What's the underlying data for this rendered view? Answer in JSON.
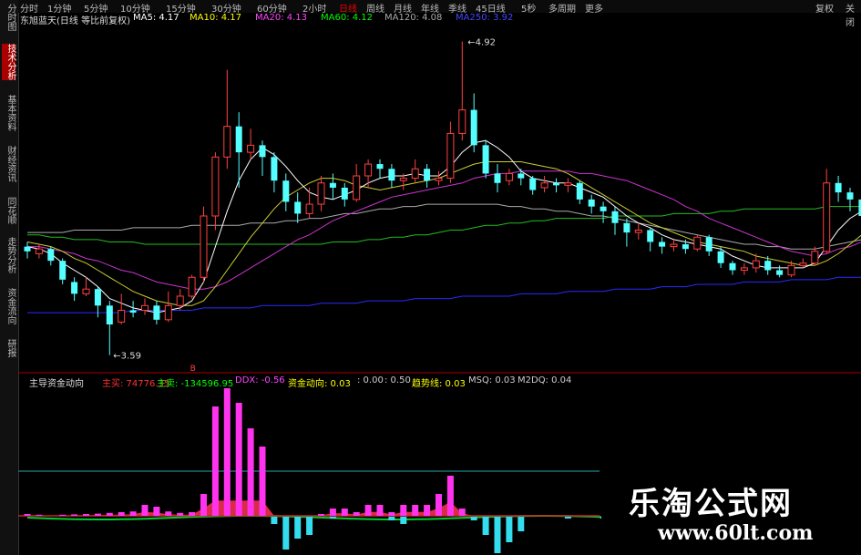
{
  "left_tabs": [
    {
      "label": "分时图",
      "active": false
    },
    {
      "label": "技术分析",
      "active": true
    },
    {
      "label": "基本资料",
      "active": false
    },
    {
      "label": "财经资讯",
      "active": false
    },
    {
      "label": "同花顺",
      "active": false
    },
    {
      "label": "走势分析",
      "active": false
    },
    {
      "label": "资金流向",
      "active": false
    },
    {
      "label": "研报",
      "active": false
    }
  ],
  "period_tabs": [
    "分时",
    "1分钟",
    "5分钟",
    "10分钟",
    "15分钟",
    "30分钟",
    "60分钟",
    "2小时",
    "日线",
    "周线",
    "月线",
    "年线",
    "季线",
    "45日线",
    "5秒",
    "多周期",
    "更多"
  ],
  "active_period": "日线",
  "right_menu": {
    "restore": "复权",
    "close": "关闭"
  },
  "main_legend": {
    "title": "东旭蓝天(日线 等比前复权)",
    "ma5": "MA5: 4.17",
    "ma10": "MA10: 4.17",
    "ma20": "MA20: 4.13",
    "ma60": "MA60: 4.12",
    "ma120": "MA120: 4.08",
    "ma250": "MA250: 3.92",
    "colors": {
      "ma5": "#ffffff",
      "ma10": "#ffff00",
      "ma20": "#ff44ff",
      "ma60": "#00ff00",
      "ma120": "#aaaaaa",
      "ma250": "#3333ff"
    }
  },
  "annotations": {
    "high": "4.92",
    "low": "3.59",
    "signal": "B"
  },
  "sub_legend": {
    "title": "主导资金动向",
    "main_buy": "主买: 74776.35",
    "main_sell": "主卖: -134596.95",
    "ddx": "DDX: -0.56",
    "fund_move": "资金动向: 0.03",
    "v1": ": 0.00",
    "v2": ": 0.50",
    "trend": "趋势线: 0.03",
    "msq": "MSQ: 0.03",
    "m2dq": "M2DQ: 0.04"
  },
  "watermark": {
    "name": "乐淘公式网",
    "url": "www.60lt.com"
  },
  "chart_data": {
    "type": "candlestick",
    "price_range": [
      3.59,
      4.92
    ],
    "candles": [
      {
        "o": 4.05,
        "c": 4.03,
        "h": 4.07,
        "l": 4.0
      },
      {
        "o": 4.02,
        "c": 4.04,
        "h": 4.06,
        "l": 4.0
      },
      {
        "o": 4.04,
        "c": 3.99,
        "h": 4.05,
        "l": 3.97
      },
      {
        "o": 3.99,
        "c": 3.91,
        "h": 4.0,
        "l": 3.89
      },
      {
        "o": 3.9,
        "c": 3.85,
        "h": 3.92,
        "l": 3.82
      },
      {
        "o": 3.85,
        "c": 3.87,
        "h": 3.92,
        "l": 3.84
      },
      {
        "o": 3.87,
        "c": 3.8,
        "h": 3.88,
        "l": 3.75
      },
      {
        "o": 3.8,
        "c": 3.72,
        "h": 3.82,
        "l": 3.59
      },
      {
        "o": 3.73,
        "c": 3.78,
        "h": 3.85,
        "l": 3.72
      },
      {
        "o": 3.78,
        "c": 3.77,
        "h": 3.82,
        "l": 3.75
      },
      {
        "o": 3.78,
        "c": 3.8,
        "h": 3.83,
        "l": 3.76
      },
      {
        "o": 3.8,
        "c": 3.74,
        "h": 3.82,
        "l": 3.72
      },
      {
        "o": 3.74,
        "c": 3.8,
        "h": 3.86,
        "l": 3.73
      },
      {
        "o": 3.8,
        "c": 3.84,
        "h": 3.87,
        "l": 3.78
      },
      {
        "o": 3.84,
        "c": 3.92,
        "h": 3.93,
        "l": 3.83
      },
      {
        "o": 3.92,
        "c": 4.18,
        "h": 4.22,
        "l": 3.9
      },
      {
        "o": 4.18,
        "c": 4.43,
        "h": 4.45,
        "l": 4.12
      },
      {
        "o": 4.43,
        "c": 4.56,
        "h": 4.8,
        "l": 4.38
      },
      {
        "o": 4.56,
        "c": 4.45,
        "h": 4.62,
        "l": 4.3
      },
      {
        "o": 4.45,
        "c": 4.48,
        "h": 4.55,
        "l": 4.42
      },
      {
        "o": 4.48,
        "c": 4.43,
        "h": 4.5,
        "l": 4.35
      },
      {
        "o": 4.43,
        "c": 4.33,
        "h": 4.45,
        "l": 4.28
      },
      {
        "o": 4.33,
        "c": 4.24,
        "h": 4.36,
        "l": 4.2
      },
      {
        "o": 4.24,
        "c": 4.19,
        "h": 4.28,
        "l": 4.15
      },
      {
        "o": 4.19,
        "c": 4.23,
        "h": 4.3,
        "l": 4.17
      },
      {
        "o": 4.23,
        "c": 4.32,
        "h": 4.35,
        "l": 4.2
      },
      {
        "o": 4.32,
        "c": 4.3,
        "h": 4.36,
        "l": 4.25
      },
      {
        "o": 4.3,
        "c": 4.25,
        "h": 4.32,
        "l": 4.22
      },
      {
        "o": 4.25,
        "c": 4.35,
        "h": 4.4,
        "l": 4.24
      },
      {
        "o": 4.35,
        "c": 4.4,
        "h": 4.42,
        "l": 4.3
      },
      {
        "o": 4.4,
        "c": 4.38,
        "h": 4.42,
        "l": 4.34
      },
      {
        "o": 4.38,
        "c": 4.33,
        "h": 4.4,
        "l": 4.3
      },
      {
        "o": 4.33,
        "c": 4.34,
        "h": 4.36,
        "l": 4.29
      },
      {
        "o": 4.34,
        "c": 4.38,
        "h": 4.42,
        "l": 4.32
      },
      {
        "o": 4.38,
        "c": 4.33,
        "h": 4.4,
        "l": 4.3
      },
      {
        "o": 4.33,
        "c": 4.34,
        "h": 4.37,
        "l": 4.31
      },
      {
        "o": 4.34,
        "c": 4.53,
        "h": 4.58,
        "l": 4.32
      },
      {
        "o": 4.53,
        "c": 4.63,
        "h": 4.92,
        "l": 4.5
      },
      {
        "o": 4.63,
        "c": 4.48,
        "h": 4.7,
        "l": 4.45
      },
      {
        "o": 4.48,
        "c": 4.36,
        "h": 4.5,
        "l": 4.34
      },
      {
        "o": 4.36,
        "c": 4.32,
        "h": 4.4,
        "l": 4.28
      },
      {
        "o": 4.33,
        "c": 4.36,
        "h": 4.38,
        "l": 4.31
      },
      {
        "o": 4.36,
        "c": 4.34,
        "h": 4.38,
        "l": 4.31
      },
      {
        "o": 4.34,
        "c": 4.29,
        "h": 4.35,
        "l": 4.27
      },
      {
        "o": 4.3,
        "c": 4.32,
        "h": 4.35,
        "l": 4.28
      },
      {
        "o": 4.32,
        "c": 4.31,
        "h": 4.34,
        "l": 4.28
      },
      {
        "o": 4.31,
        "c": 4.32,
        "h": 4.34,
        "l": 4.28
      },
      {
        "o": 4.32,
        "c": 4.25,
        "h": 4.33,
        "l": 4.23
      },
      {
        "o": 4.25,
        "c": 4.22,
        "h": 4.27,
        "l": 4.19
      },
      {
        "o": 4.22,
        "c": 4.2,
        "h": 4.24,
        "l": 4.15
      },
      {
        "o": 4.2,
        "c": 4.15,
        "h": 4.22,
        "l": 4.1
      },
      {
        "o": 4.15,
        "c": 4.11,
        "h": 4.17,
        "l": 4.05
      },
      {
        "o": 4.11,
        "c": 4.12,
        "h": 4.15,
        "l": 4.08
      },
      {
        "o": 4.12,
        "c": 4.07,
        "h": 4.13,
        "l": 4.03
      },
      {
        "o": 4.07,
        "c": 4.05,
        "h": 4.09,
        "l": 4.02
      },
      {
        "o": 4.05,
        "c": 4.06,
        "h": 4.08,
        "l": 4.03
      },
      {
        "o": 4.06,
        "c": 4.04,
        "h": 4.08,
        "l": 4.02
      },
      {
        "o": 4.04,
        "c": 4.09,
        "h": 4.1,
        "l": 4.03
      },
      {
        "o": 4.09,
        "c": 4.03,
        "h": 4.1,
        "l": 4.01
      },
      {
        "o": 4.03,
        "c": 3.98,
        "h": 4.05,
        "l": 3.96
      },
      {
        "o": 3.98,
        "c": 3.95,
        "h": 3.99,
        "l": 3.93
      },
      {
        "o": 3.95,
        "c": 3.96,
        "h": 3.98,
        "l": 3.93
      },
      {
        "o": 3.96,
        "c": 3.99,
        "h": 4.02,
        "l": 3.94
      },
      {
        "o": 3.99,
        "c": 3.95,
        "h": 4.01,
        "l": 3.93
      },
      {
        "o": 3.95,
        "c": 3.93,
        "h": 3.97,
        "l": 3.92
      },
      {
        "o": 3.93,
        "c": 3.97,
        "h": 3.99,
        "l": 3.92
      },
      {
        "o": 3.97,
        "c": 3.98,
        "h": 4.0,
        "l": 3.96
      },
      {
        "o": 3.98,
        "c": 4.03,
        "h": 4.05,
        "l": 3.97
      },
      {
        "o": 4.03,
        "c": 4.32,
        "h": 4.38,
        "l": 4.02
      },
      {
        "o": 4.32,
        "c": 4.28,
        "h": 4.35,
        "l": 4.24
      },
      {
        "o": 4.28,
        "c": 4.25,
        "h": 4.3,
        "l": 4.2
      },
      {
        "o": 4.25,
        "c": 4.18,
        "h": 4.27,
        "l": 4.14
      }
    ],
    "ma5": [
      4.05,
      4.04,
      4.02,
      3.98,
      3.95,
      3.92,
      3.88,
      3.83,
      3.81,
      3.79,
      3.78,
      3.77,
      3.78,
      3.79,
      3.82,
      3.9,
      4.05,
      4.2,
      4.33,
      4.42,
      4.47,
      4.44,
      4.39,
      4.33,
      4.28,
      4.26,
      4.25,
      4.27,
      4.29,
      4.32,
      4.34,
      4.35,
      4.35,
      4.36,
      4.35,
      4.35,
      4.39,
      4.45,
      4.49,
      4.5,
      4.47,
      4.43,
      4.37,
      4.34,
      4.33,
      4.32,
      4.32,
      4.3,
      4.28,
      4.26,
      4.22,
      4.18,
      4.15,
      4.13,
      4.1,
      4.08,
      4.07,
      4.06,
      4.05,
      4.04,
      4.01,
      3.99,
      3.97,
      3.96,
      3.96,
      3.96,
      3.96,
      3.98,
      4.05,
      4.12,
      4.17,
      4.2
    ],
    "ma10": [
      4.07,
      4.06,
      4.05,
      4.03,
      4.0,
      3.98,
      3.95,
      3.92,
      3.89,
      3.86,
      3.84,
      3.82,
      3.81,
      3.8,
      3.8,
      3.82,
      3.88,
      3.95,
      4.02,
      4.09,
      4.15,
      4.21,
      4.26,
      4.29,
      4.32,
      4.34,
      4.34,
      4.33,
      4.31,
      4.3,
      4.29,
      4.3,
      4.31,
      4.32,
      4.33,
      4.34,
      4.36,
      4.38,
      4.4,
      4.41,
      4.41,
      4.41,
      4.41,
      4.4,
      4.39,
      4.38,
      4.36,
      4.33,
      4.3,
      4.27,
      4.24,
      4.21,
      4.18,
      4.15,
      4.13,
      4.11,
      4.09,
      4.07,
      4.06,
      4.05,
      4.04,
      4.03,
      4.01,
      4.0,
      3.99,
      3.98,
      3.97,
      3.97,
      3.99,
      4.02,
      4.06,
      4.1
    ],
    "ma20": [
      4.05,
      4.05,
      4.04,
      4.03,
      4.02,
      4.0,
      3.99,
      3.97,
      3.95,
      3.94,
      3.92,
      3.9,
      3.89,
      3.88,
      3.87,
      3.87,
      3.88,
      3.9,
      3.93,
      3.96,
      3.99,
      4.02,
      4.05,
      4.08,
      4.1,
      4.13,
      4.16,
      4.18,
      4.2,
      4.22,
      4.24,
      4.26,
      4.27,
      4.28,
      4.29,
      4.3,
      4.31,
      4.32,
      4.34,
      4.35,
      4.36,
      4.36,
      4.37,
      4.37,
      4.37,
      4.37,
      4.37,
      4.36,
      4.36,
      4.35,
      4.34,
      4.33,
      4.31,
      4.29,
      4.27,
      4.25,
      4.22,
      4.2,
      4.17,
      4.15,
      4.13,
      4.11,
      4.09,
      4.07,
      4.05,
      4.03,
      4.02,
      4.01,
      4.02,
      4.04,
      4.05,
      4.07
    ],
    "ma60": [
      4.1,
      4.1,
      4.09,
      4.09,
      4.08,
      4.08,
      4.08,
      4.07,
      4.07,
      4.07,
      4.06,
      4.06,
      4.06,
      4.06,
      4.06,
      4.06,
      4.06,
      4.06,
      4.06,
      4.06,
      4.06,
      4.06,
      4.06,
      4.06,
      4.06,
      4.06,
      4.07,
      4.07,
      4.07,
      4.08,
      4.08,
      4.09,
      4.09,
      4.1,
      4.1,
      4.11,
      4.12,
      4.12,
      4.13,
      4.14,
      4.14,
      4.15,
      4.15,
      4.16,
      4.16,
      4.17,
      4.17,
      4.17,
      4.17,
      4.17,
      4.18,
      4.18,
      4.18,
      4.18,
      4.18,
      4.19,
      4.19,
      4.19,
      4.19,
      4.2,
      4.2,
      4.21,
      4.21,
      4.21,
      4.21,
      4.21,
      4.21,
      4.21,
      4.22,
      4.22,
      4.22,
      4.22
    ],
    "ma120": [
      4.11,
      4.11,
      4.11,
      4.11,
      4.12,
      4.12,
      4.12,
      4.12,
      4.12,
      4.13,
      4.13,
      4.13,
      4.13,
      4.13,
      4.14,
      4.14,
      4.14,
      4.14,
      4.14,
      4.15,
      4.15,
      4.15,
      4.16,
      4.16,
      4.17,
      4.17,
      4.18,
      4.19,
      4.19,
      4.2,
      4.21,
      4.21,
      4.22,
      4.22,
      4.23,
      4.23,
      4.23,
      4.23,
      4.23,
      4.23,
      4.23,
      4.22,
      4.22,
      4.21,
      4.21,
      4.2,
      4.2,
      4.19,
      4.18,
      4.18,
      4.17,
      4.16,
      4.15,
      4.14,
      4.13,
      4.12,
      4.11,
      4.1,
      4.09,
      4.08,
      4.07,
      4.06,
      4.06,
      4.05,
      4.05,
      4.04,
      4.04,
      4.04,
      4.05,
      4.06,
      4.07,
      4.08
    ],
    "ma250": [
      3.77,
      3.77,
      3.77,
      3.77,
      3.77,
      3.77,
      3.77,
      3.77,
      3.77,
      3.78,
      3.78,
      3.78,
      3.78,
      3.78,
      3.78,
      3.79,
      3.79,
      3.79,
      3.79,
      3.79,
      3.8,
      3.8,
      3.8,
      3.8,
      3.8,
      3.81,
      3.81,
      3.81,
      3.81,
      3.82,
      3.82,
      3.82,
      3.82,
      3.83,
      3.83,
      3.83,
      3.83,
      3.84,
      3.84,
      3.84,
      3.84,
      3.84,
      3.85,
      3.85,
      3.85,
      3.85,
      3.86,
      3.86,
      3.86,
      3.86,
      3.87,
      3.87,
      3.87,
      3.87,
      3.88,
      3.88,
      3.88,
      3.89,
      3.89,
      3.89,
      3.89,
      3.9,
      3.9,
      3.9,
      3.9,
      3.91,
      3.91,
      3.91,
      3.91,
      3.92,
      3.92,
      3.92
    ],
    "sub_bars": [
      0,
      0,
      0,
      0,
      0,
      0,
      0,
      0,
      0,
      0,
      0,
      0,
      0,
      0,
      0,
      0,
      0,
      0,
      0,
      0,
      0,
      -0.2,
      -0.9,
      -0.6,
      -0.5,
      0.05,
      -0.05,
      0.05,
      0.1,
      0.05,
      0.05,
      -0.1,
      -0.2,
      0.05,
      0.1,
      0.05,
      0.1,
      0.8,
      -0.1,
      -0.5,
      -1.0,
      -0.7,
      -0.4,
      0.05,
      0,
      0,
      -0.05,
      0,
      0,
      -0.05,
      -0.1,
      0,
      -0.05,
      0,
      0,
      -0.05,
      0,
      0,
      0,
      0,
      -0.1,
      0,
      0,
      -0.05,
      -0.05,
      -0.05,
      0,
      0,
      0,
      0,
      0,
      0
    ],
    "sub_magenta": [
      0.05,
      0.03,
      0.02,
      0.03,
      0.04,
      0.05,
      0.06,
      0.08,
      0.1,
      0.12,
      0.3,
      0.25,
      0.12,
      0.08,
      0.1,
      0.6,
      3.0,
      3.5,
      3.1,
      2.4,
      1.9,
      0,
      0,
      0,
      0,
      0.05,
      0.2,
      0.2,
      0.1,
      0.3,
      0.3,
      0.1,
      0.3,
      0.3,
      0.3,
      0.6,
      1.1,
      0.2,
      0,
      0,
      0,
      0,
      0,
      0,
      0,
      0,
      0,
      0,
      0,
      0,
      0,
      0,
      0,
      0,
      0,
      0,
      0,
      0,
      0,
      0,
      0,
      0,
      0,
      0,
      0,
      0,
      0,
      0,
      0,
      0,
      0,
      0
    ]
  }
}
